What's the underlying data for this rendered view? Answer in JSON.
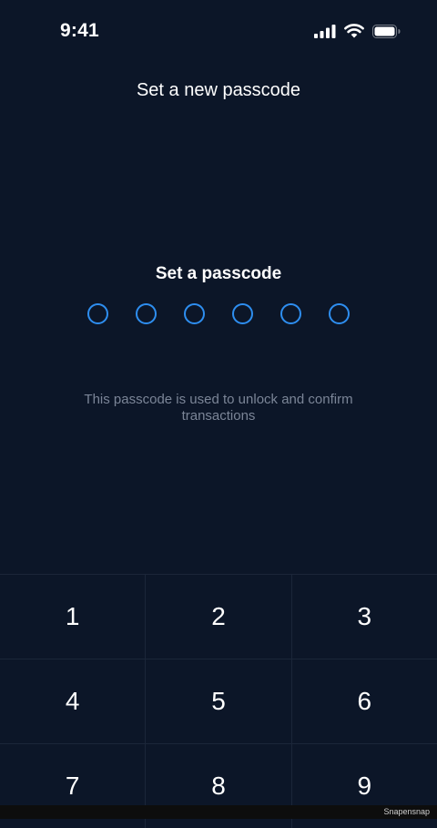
{
  "status_bar": {
    "time": "9:41",
    "icons": [
      "cellular-signal-icon",
      "wifi-icon",
      "battery-icon"
    ]
  },
  "header": {
    "title": "Set a new passcode"
  },
  "passcode": {
    "prompt": "Set a passcode",
    "digits_total": 6,
    "digits_entered": 0,
    "hint": "This passcode is used to unlock and confirm transactions"
  },
  "keypad": {
    "keys": [
      "1",
      "2",
      "3",
      "4",
      "5",
      "6",
      "7",
      "8",
      "9"
    ]
  },
  "footer": {
    "watermark": "Snapensnap"
  },
  "colors": {
    "background": "#0c1628",
    "accent": "#2e8ef0",
    "hint_text": "#7b8597"
  }
}
